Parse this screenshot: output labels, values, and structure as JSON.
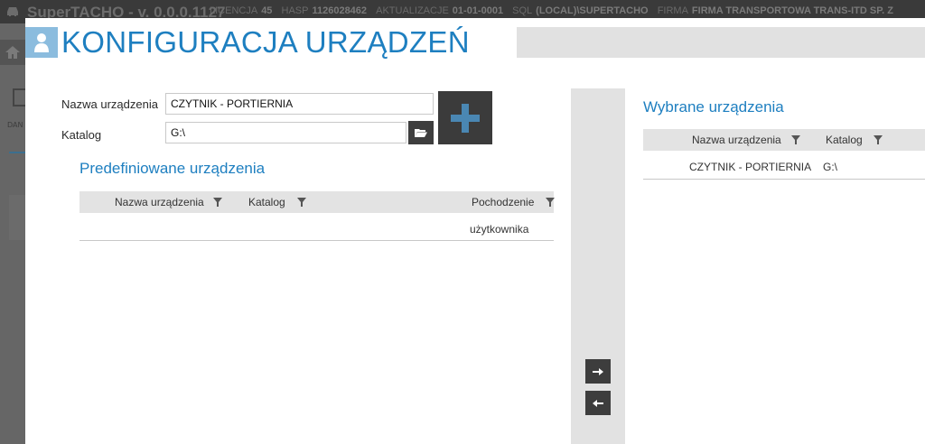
{
  "app": {
    "name": "SuperTACHO - v. 0.0.0.1127",
    "meta": [
      {
        "label": "LICENCJA",
        "value": "45"
      },
      {
        "label": "HASP",
        "value": "1126028462"
      },
      {
        "label": "AKTUALIZACJE",
        "value": "01-01-0001"
      },
      {
        "label": "SQL",
        "value": "(LOCAL)\\SUPERTACHO"
      },
      {
        "label": "FIRMA",
        "value": "FIRMA TRANSPORTOWA TRANS-ITD SP. Z"
      }
    ],
    "sidebar_tab": "DAN"
  },
  "dialog": {
    "title": "KONFIGURACJA URZĄDZEŃ",
    "form": {
      "name_label": "Nazwa urządzenia",
      "name_value": "CZYTNIK - PORTIERNIA",
      "dir_label": "Katalog",
      "dir_value": "G:\\"
    },
    "predefined": {
      "title": "Predefiniowane urządzenia",
      "columns": [
        "Nazwa urządzenia",
        "Katalog",
        "Pochodzenie"
      ],
      "rows": [
        {
          "name": "",
          "dir": "",
          "origin": "użytkownika"
        }
      ]
    },
    "selected": {
      "title": "Wybrane urządzenia",
      "columns": [
        "Nazwa urządzenia",
        "Katalog"
      ],
      "rows": [
        {
          "name": "CZYTNIK - PORTIERNIA",
          "dir": "G:\\"
        }
      ]
    },
    "icons": {
      "user": "user-icon",
      "folder": "folder-open-icon",
      "add": "plus-icon",
      "move_right": "arrow-right-icon",
      "move_left": "arrow-left-icon",
      "filter": "filter-icon"
    },
    "colors": {
      "accent": "#1e7fc0",
      "dark_button": "#3d3d3d",
      "grid_header": "#e3e3e3"
    }
  }
}
